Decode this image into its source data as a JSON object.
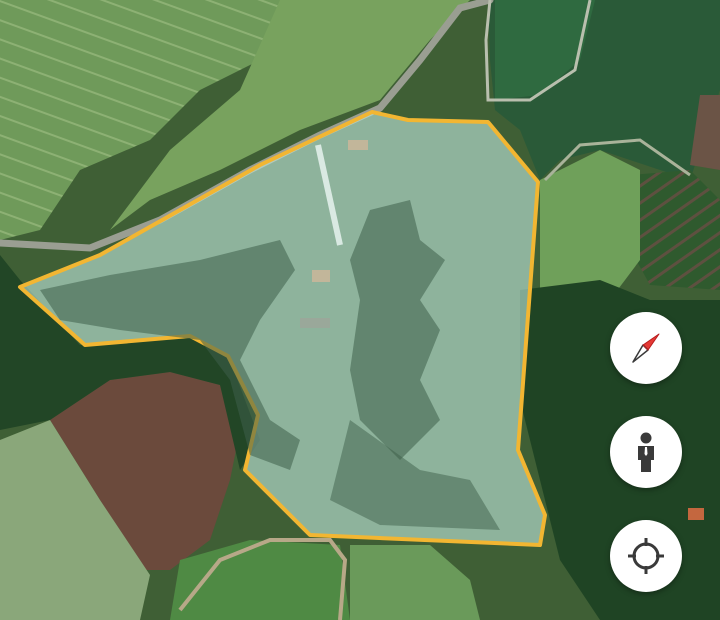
{
  "map": {
    "type": "satellite",
    "parcel_outline_color": "#f2b632",
    "parcel_fill_color": "#bfe6dc"
  },
  "controls": [
    {
      "name": "compass",
      "icon": "compass-icon"
    },
    {
      "name": "street-view",
      "icon": "person-icon"
    },
    {
      "name": "my-location",
      "icon": "crosshair-icon"
    }
  ],
  "colors": {
    "button_bg": "#ffffff",
    "compass_red": "#e53935",
    "icon_dark": "#3a3a3a"
  }
}
